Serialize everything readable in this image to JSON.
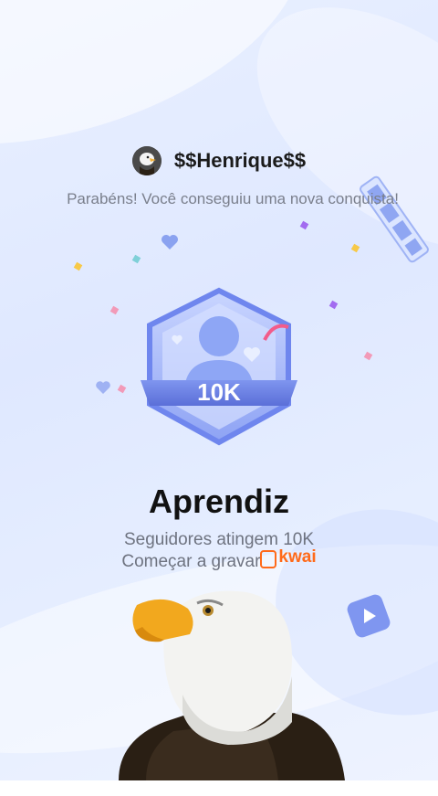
{
  "profile": {
    "username": "$$Henrique$$",
    "avatar_icon": "eagle-avatar-icon"
  },
  "message": {
    "congrats": "Parabéns! Você conseguiu uma nova conquista!"
  },
  "badge": {
    "value_label": "10K",
    "icon": "follower-badge-icon"
  },
  "achievement": {
    "title": "Aprendiz",
    "subtitle": "Seguidores atingem 10K",
    "cta_prefix": "Começar a gravar",
    "brand": "kwai"
  },
  "colors": {
    "accent": "#6f86ee",
    "badge_dark": "#5b6fd8",
    "brand_orange": "#ff6a1a"
  }
}
